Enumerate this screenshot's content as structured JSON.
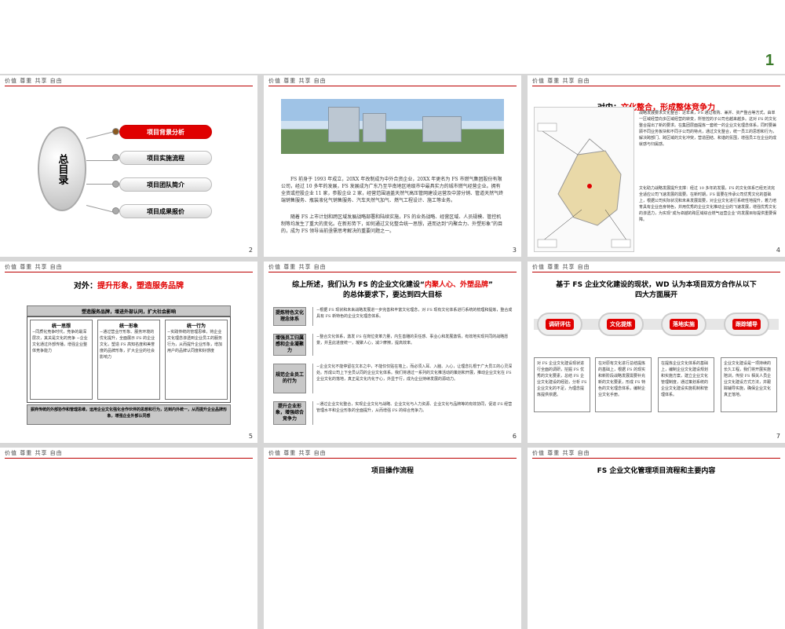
{
  "header_text": "价值 尊重 共享 自由",
  "corner_number": "1",
  "slide1": {
    "page": "2",
    "circle_label": "总目录",
    "items": [
      "项目背景分析",
      "项目实施流程",
      "项目团队简介",
      "项目成果报价"
    ]
  },
  "slide2": {
    "page": "3",
    "para1": "FS 前身于 1993 年成立，20XX 年改制成为中外合资企业，20XX 年更名为 FS 市燃气集团股份有限公司，经过 10 多年的发展，FS 发展成为广东乃至华南地区地级市中最具实力的城市燃气经营企业。拥有全资或控股企业 11 家，参股企业 2 家，经营范围涵盖天然气高压管网建设运营及中游分销、管道天然气终端销售服务、瓶装液化气销售服务、汽车天然气加气、燃气工程设计、施工等业务。",
    "para2": "随着 FS 上市计划和跨区域发展战略部署和陆续实施，FS 的业务战略、经营区域、人员规模、管控机制等均发生了重大的变化。在新形势下，如何通过文化整合统一思想，进而达到“内聚合力、外塑形象”的目的，成为 FS 领导当前亟需思考解决的重要问题之一。"
  },
  "slide3": {
    "page": "4",
    "title_prefix": "对内：",
    "title_red": "文化整合，形成整体竞争力",
    "p1": "战略发展要求文化整合：近年来，FS 通过收购、兼并、资产整合等方式，由单一区域经营向多区域经营的转变，所管控的子公司也越来越多。这对 FS 的文化整合提出了新的要求。在集团层面提炼一套统一的企业文化理念体系，同时要兼顾不同业务板块和不同子公司的特点，通过文化整合，统一员工的思想和行为，解决跨部门、跨区域的文化冲突，营造团结、和谐的氛围，增强员工在企业的成就感与归属感。",
    "p2": "文化助力战略发展提升支撑：经过 10 多年的发展，FS 的文化体系已经无法完全适应公司飞速发展的需要。在新时期，FS 需要在传承公司优秀文化的基础上，根据公司实际状况和未来发展需要，对企业文化进行系统性地提升，着力培育具有企业自身特色，并用优秀的企业文化推动企业的飞速发展，增强优秀文化的渗透力，为实现“成为卓越的跨区域综合燃气运营企业”的发展目标提供重要保障。"
  },
  "slide4": {
    "page": "5",
    "title_prefix": "对外：",
    "title_red": "提升形象，塑造服务品牌",
    "banner": "塑造服务品牌，增进外部认同，扩大社会影响",
    "cols": [
      {
        "head": "统一思想",
        "body": "−同质化竞争时代，竞争的最深层次，其关是文化的竞争 −企业文化通过外部传播，增强企业整体竞争能力"
      },
      {
        "head": "统一形象",
        "body": "−通过营业厅形象、服务环境的优化提升，全面展示 FS 的企业文化，塑造 FS 高知名度和美誉度的品牌形象，扩大企业的社会影响力"
      },
      {
        "head": "统一行为",
        "body": "−实践传统的管理思维，将企业文化理念渗透到企业员工的服务行为，从而提升企业形象，增加用户的品牌认同度和好感度"
      }
    ],
    "footer": "摒弃传统的外部协作和管理思维，运用企业文化强化合作伙伴的思想和行为，达到内外统一，从而提升企业品牌形象，增强企业外部认同感"
  },
  "slide5": {
    "page": "6",
    "title_l1_a": "综上所述，我们认为 FS 的企业文化建设“",
    "title_l1_red": "内聚人心、外塑品牌",
    "title_l1_b": "”",
    "title_l2": "的总体要求下，要达到四大目标",
    "rows": [
      {
        "label": "提炼特色文化理念体系",
        "text": "−根据 FS 现状和未来战略发展进一步完善和丰富文化理念，对 FS 现有文化体系进行系统的梳理和提炼，整合成具有 FS 新特色的企业文化理念体系。"
      },
      {
        "label": "增强员工归属感和企业凝聚力",
        "text": "−整合文化体系，激发 FS 在岗位变革力量，内生善雕的责任感、事业心和发展激情，有效地实现共同的战略愿景，并且此进度统一，凝聚人心，减少摩擦，提高效率。"
      },
      {
        "label": "规范企业员工的行为",
        "text": "−企业文化不能停留在文本之中，不能仅仅贴在墙上，而必须入耳、入脑、入心，让理念扎根于广大员工的心灵深处。形成公司上下全员认同的企业文化体系。我们将通过一系列的文化推活动的策划和开展，推动企业文化在 FS 企业文化的落地，真正是文化内化于心，外显于行，成为企业持续发展的源动力。"
      },
      {
        "label": "提升企业形象，增强综合竞争力",
        "text": "−通过企业文化整合，实现企业文化与战略、企业文化与人力资源、企业文化与品牌等的有效协同，促进 FS 经营管理水平和企业形象的全面提升，从而增强 FS 的综合竞争力。"
      }
    ]
  },
  "slide6": {
    "page": "7",
    "title_l1": "基于 FS 企业文化建设的现状，WD 认为本项目双方合作从以下",
    "title_l2": "四大方面展开",
    "steps": [
      "调研评估",
      "文化提炼",
      "落地实施",
      "跟踪辅导"
    ],
    "cards": [
      "对 FS 企业文化建设现状进行全面的调研，挖掘 FS 优秀的文化要素，总结 FS 企业文化建设的经验，分析 FS 企业文化的不足，为理念提炼提供依据。",
      "在对原有文化进行总结提炼的基础上，根据 FS 的现实和新阶段战略发展需要补充新的文化要素，形成 FS 特色的文化理念体系，编制企业文化手册。",
      "在提炼企业文化体系的基础上，编制企业文化建设规划和实施方案，建立企业文化管理制度，通过策划系统的企业文化建设实施机制和管理体系。",
      "企业文化建设是一项持续的长久工程，我们将开展实施陪训，传授 FS 相关人员企业文化建设方式方法，并跟踪辅导实施，确保企业文化真正落地。"
    ]
  },
  "slide7": {
    "title": "项目操作流程"
  },
  "slide8": {
    "title": "FS 企业文化管理项目流程和主要内容"
  }
}
